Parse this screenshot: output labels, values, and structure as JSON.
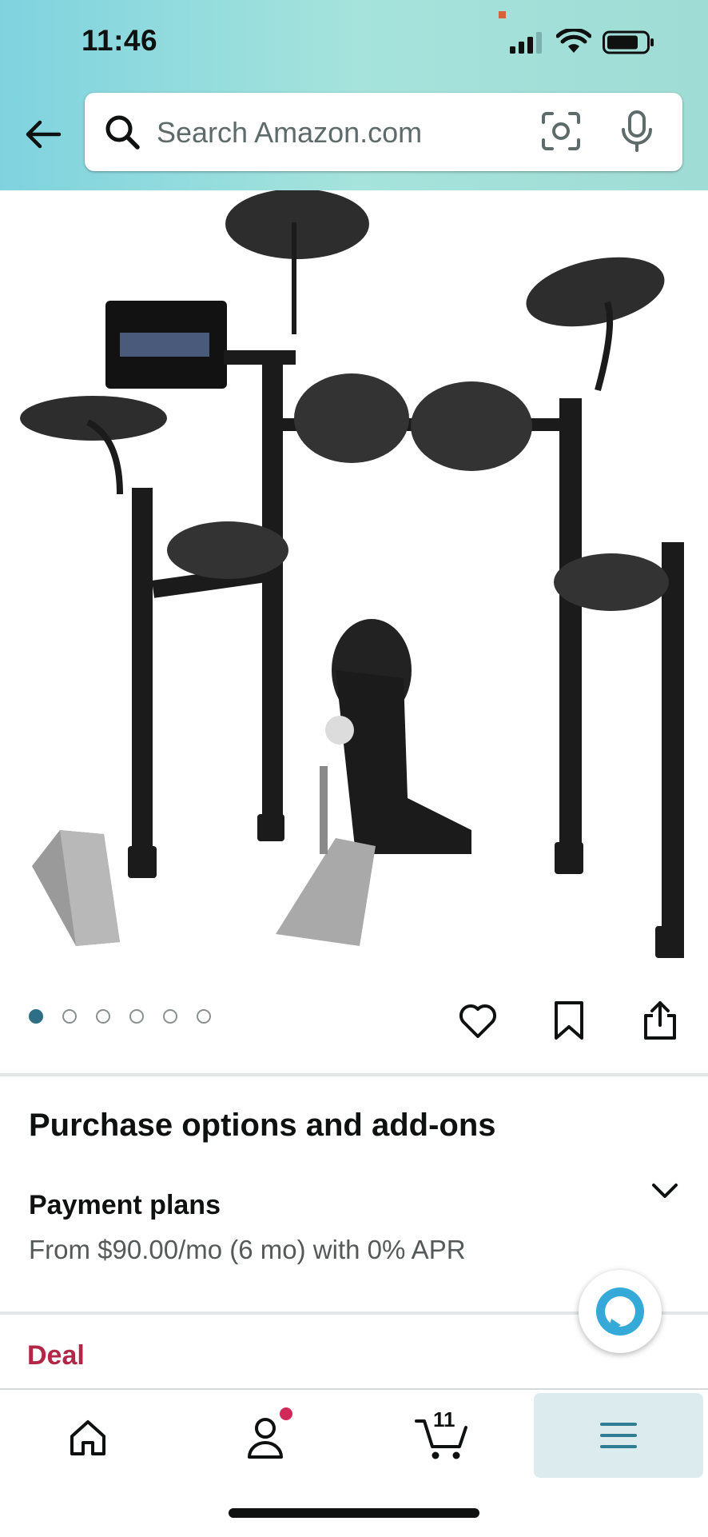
{
  "status_bar": {
    "time": "11:46"
  },
  "search": {
    "placeholder": "Search Amazon.com"
  },
  "product": {
    "image_alt": "Yamaha DTX electronic drum kit"
  },
  "carousel": {
    "count": 6,
    "active_index": 0
  },
  "purchase_options": {
    "title": "Purchase options and add-ons",
    "payment_plans_title": "Payment plans",
    "payment_plans_detail": "From $90.00/mo (6 mo) with 0% APR"
  },
  "deal": {
    "label": "Deal"
  },
  "bottom_nav": {
    "items": [
      "home",
      "account",
      "cart",
      "menu"
    ],
    "cart_count": "11",
    "active": "menu"
  },
  "colors": {
    "accent": "#2e6f86",
    "deal": "#b12748",
    "badge": "#d1295a"
  }
}
